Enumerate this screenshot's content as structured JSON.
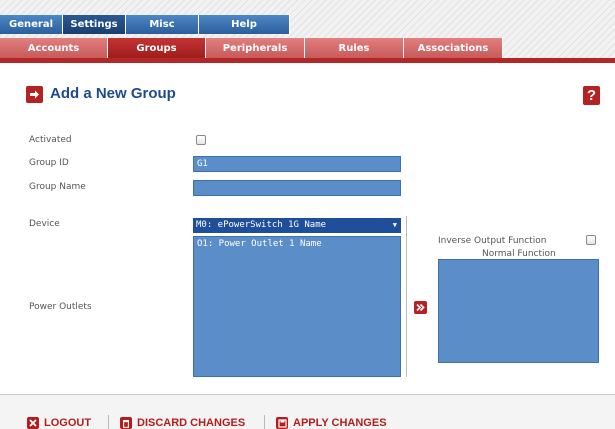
{
  "nav": {
    "tabs": [
      {
        "label": "General"
      },
      {
        "label": "Settings"
      },
      {
        "label": "Misc"
      },
      {
        "label": "Help"
      }
    ],
    "subtabs": [
      {
        "label": "Accounts"
      },
      {
        "label": "Groups"
      },
      {
        "label": "Peripherals"
      },
      {
        "label": "Rules"
      },
      {
        "label": "Associations"
      }
    ]
  },
  "page": {
    "title": "Add a New Group",
    "help_icon_label": "?"
  },
  "form": {
    "activated_label": "Activated",
    "group_id_label": "Group ID",
    "group_id_value": "G1",
    "group_name_label": "Group Name",
    "group_name_value": "",
    "device_label": "Device",
    "device_value": "M0: ePowerSwitch 1G Name",
    "power_outlets_label": "Power Outlets",
    "outlets": [
      "O1: Power Outlet 1 Name"
    ],
    "inverse_label": "Inverse Output Function",
    "normal_label": "Normal Function"
  },
  "footer": {
    "logout": "LOGOUT",
    "discard": "DISCARD CHANGES",
    "apply": "APPLY CHANGES"
  },
  "colors": {
    "accent_red": "#b62121",
    "accent_blue": "#2c5e9b",
    "field_blue": "#5b8ec8"
  },
  "icons": {
    "header": "arrow-right-icon",
    "help": "help-icon",
    "move": "double-chevron-right-icon",
    "logout": "close-icon",
    "discard": "trash-icon",
    "apply": "save-icon"
  }
}
